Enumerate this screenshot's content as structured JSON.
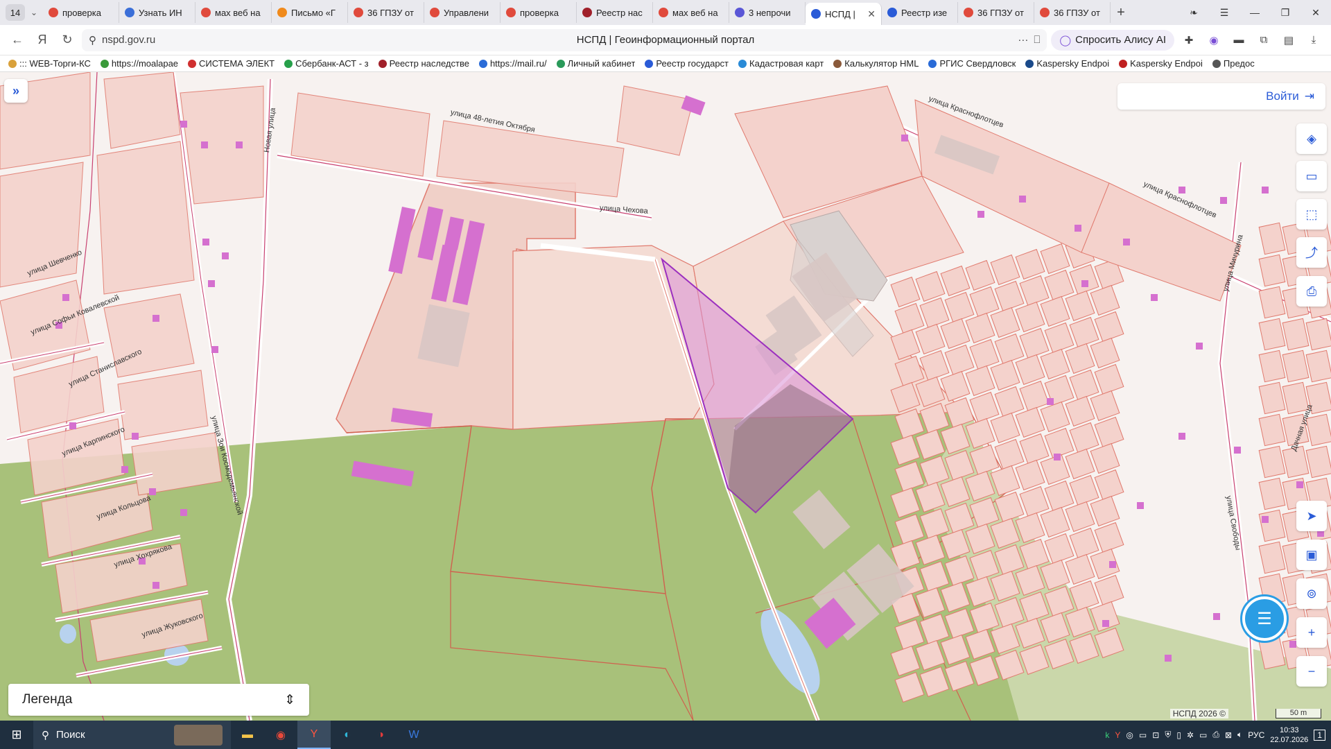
{
  "browser": {
    "tab_count": "14",
    "tabs": [
      {
        "label": "проверка",
        "icon": "yandex-icon",
        "color": "#e04a3c"
      },
      {
        "label": "Узнать ИН",
        "icon": "shield-icon",
        "color": "#3b6fd8"
      },
      {
        "label": "мах веб на",
        "icon": "yandex-icon",
        "color": "#e04a3c"
      },
      {
        "label": "Письмо «Г",
        "icon": "mail-icon",
        "color": "#f08a1c"
      },
      {
        "label": "36 ГПЗУ от",
        "icon": "pdf-icon",
        "color": "#e04a3c"
      },
      {
        "label": "Управлени",
        "icon": "pdf-icon",
        "color": "#e04a3c"
      },
      {
        "label": "проверка",
        "icon": "yandex-icon",
        "color": "#e04a3c"
      },
      {
        "label": "Реестр нас",
        "icon": "registry-icon",
        "color": "#a0202a"
      },
      {
        "label": "мах веб на",
        "icon": "yandex-icon",
        "color": "#e04a3c"
      },
      {
        "label": "3 непрочи",
        "icon": "messenger-icon",
        "color": "#5a56d6"
      },
      {
        "label": "НСПД |",
        "icon": "nspd-icon",
        "color": "#2a5bd7",
        "active": true
      },
      {
        "label": "Реестр изе",
        "icon": "eagle-icon",
        "color": "#2a5bd7"
      },
      {
        "label": "36 ГПЗУ от",
        "icon": "pdf-icon",
        "color": "#e04a3c"
      },
      {
        "label": "36 ГПЗУ от",
        "icon": "pdf-icon",
        "color": "#e04a3c"
      }
    ],
    "url": "nspd.gov.ru",
    "page_title": "НСПД | Геоинформационный портал",
    "alice_label": "Спросить Алису AI",
    "bookmarks": [
      {
        "label": "::: WEB-Торги-КС",
        "color": "#d9a13b"
      },
      {
        "label": "https://moalapae",
        "color": "#3a9a3a"
      },
      {
        "label": "СИСТЕМА ЭЛЕКТ",
        "color": "#d03030"
      },
      {
        "label": "Сбербанк-АСТ - з",
        "color": "#27a04a"
      },
      {
        "label": "Реестр наследстве",
        "color": "#a0202a"
      },
      {
        "label": "https://mail.ru/",
        "color": "#2a6bd7"
      },
      {
        "label": "Личный кабинет",
        "color": "#2a9a5a"
      },
      {
        "label": "Реестр государст",
        "color": "#2a5bd7"
      },
      {
        "label": "Кадастровая карт",
        "color": "#2a8bd7"
      },
      {
        "label": "Калькулятор НМL",
        "color": "#8a5a3a"
      },
      {
        "label": "РГИС Свердловск",
        "color": "#2a6bd7"
      },
      {
        "label": "Kaspersky Endpoi",
        "color": "#1a4a8a"
      },
      {
        "label": "Kaspersky Endpoi",
        "color": "#c02020"
      },
      {
        "label": "Предос",
        "color": "#555555"
      }
    ]
  },
  "map": {
    "login_label": "Войти",
    "legend_label": "Легенда",
    "copyright": "НСПД 2026 ©",
    "scale_label": "50 m",
    "streets": [
      "улица 48-летия Октября",
      "улица Чехова",
      "улица Краснофлотцев",
      "улица Краснофлотцев",
      "Новая улица",
      "улица Шевченко",
      "улица Софьи Ковалевской",
      "улица Станиславского",
      "улица Карпинского",
      "улица Кольцова",
      "улица Хохрякова",
      "улица Жуковского",
      "улица Зои Космодемьянской",
      "улица Мичурина",
      "улица Свободы",
      "Дачная улица"
    ],
    "colors": {
      "land": "#f7f2f0",
      "parcel_fill": "#f4d2cc",
      "parcel_stroke": "#e07a6e",
      "greenery": "#a8c17a",
      "building": "#d570cf",
      "selected": "#9b2fbf",
      "water": "#b8d2ee"
    }
  },
  "taskbar": {
    "search_label": "Поиск",
    "language": "РУС",
    "time": "10:33",
    "date": "22.07.2026",
    "notifications": "1"
  }
}
